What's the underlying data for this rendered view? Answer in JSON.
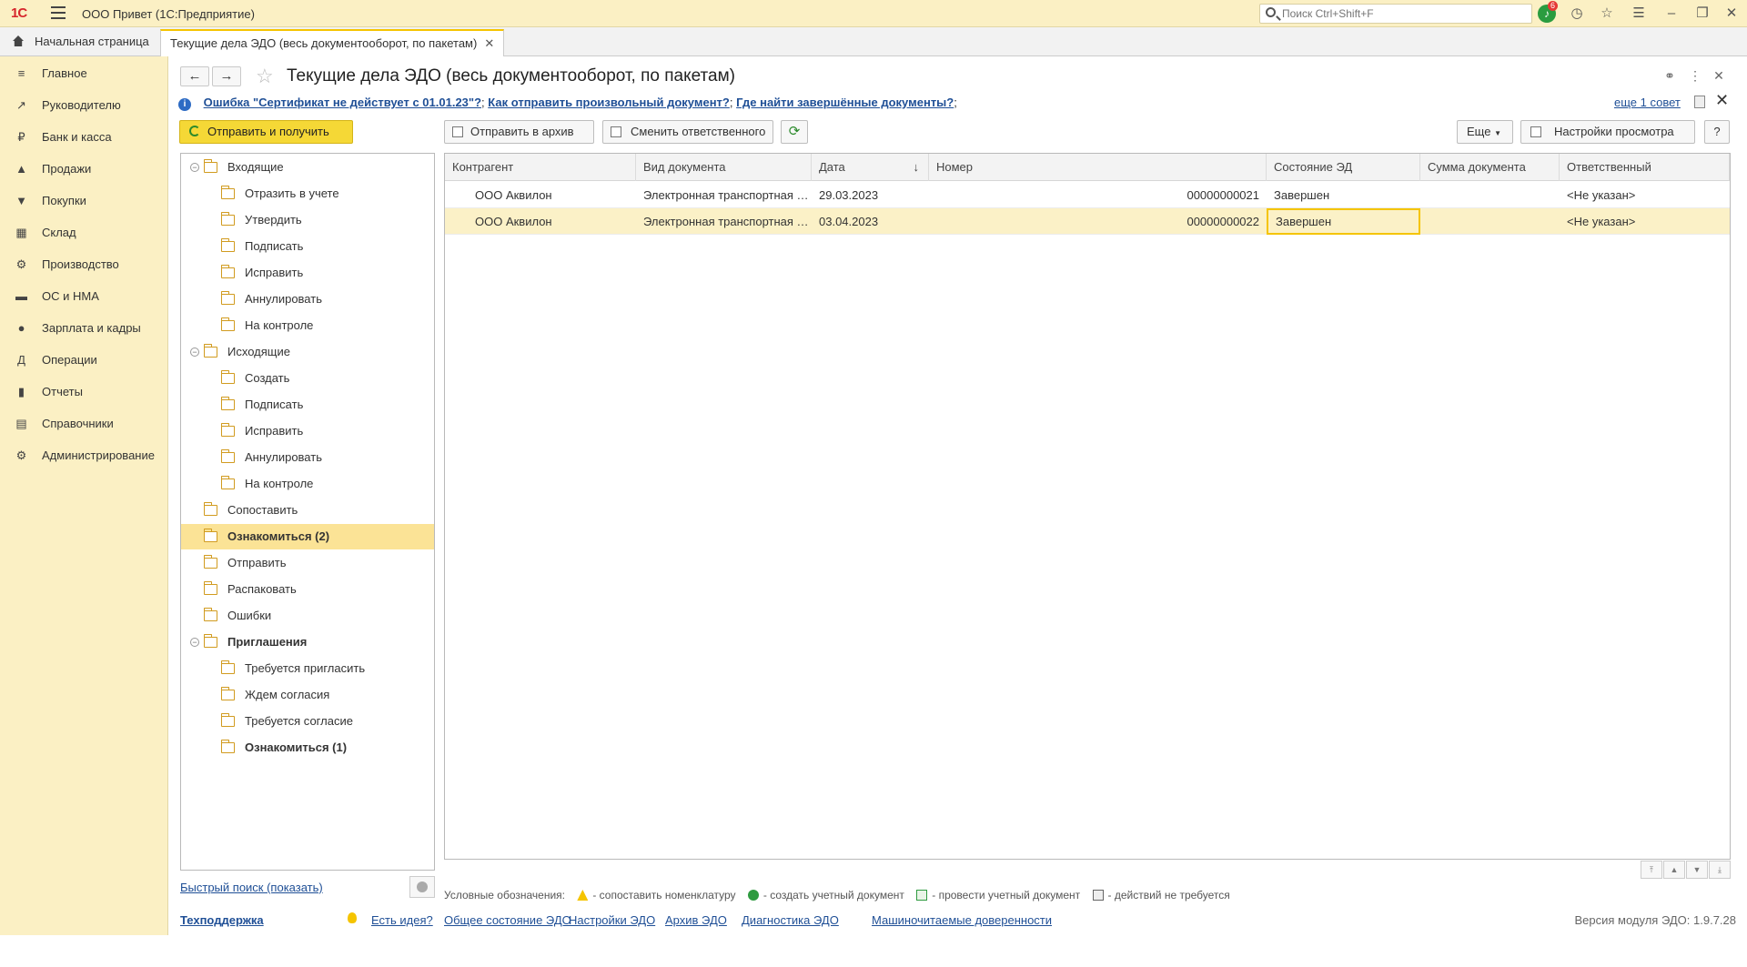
{
  "app": {
    "logo": "1С",
    "title": "ООО Привет  (1С:Предприятие)",
    "search_placeholder": "Поиск Ctrl+Shift+F",
    "notifications_count": "6"
  },
  "tabs": {
    "home_label": "Начальная страница",
    "current_label": "Текущие дела ЭДО (весь документооборот, по пакетам)"
  },
  "sidebar": {
    "items": [
      {
        "label": "Главное",
        "icon": "≡"
      },
      {
        "label": "Руководителю",
        "icon": "↗"
      },
      {
        "label": "Банк и касса",
        "icon": "₽"
      },
      {
        "label": "Продажи",
        "icon": "▲"
      },
      {
        "label": "Покупки",
        "icon": "▼"
      },
      {
        "label": "Склад",
        "icon": "▦"
      },
      {
        "label": "Производство",
        "icon": "⚙"
      },
      {
        "label": "ОС и НМА",
        "icon": "▬"
      },
      {
        "label": "Зарплата и кадры",
        "icon": "●"
      },
      {
        "label": "Операции",
        "icon": "Д"
      },
      {
        "label": "Отчеты",
        "icon": "▮"
      },
      {
        "label": "Справочники",
        "icon": "▤"
      },
      {
        "label": "Администрирование",
        "icon": "⚙"
      }
    ]
  },
  "form": {
    "title": "Текущие дела ЭДО (весь документооборот, по пакетам)"
  },
  "tips": {
    "link1": "Ошибка \"Сертификат не действует с 01.01.23\"?",
    "link2": "Как отправить произвольный документ?",
    "link3": "Где найти завершённые документы?",
    "sep": ";",
    "more": "еще 1 совет"
  },
  "toolbar": {
    "send_receive": "Отправить и получить",
    "archive": "Отправить в архив",
    "change_responsible": "Сменить ответственного",
    "more": "Еще",
    "view_settings": "Настройки просмотра",
    "help": "?"
  },
  "tree": [
    {
      "label": "Входящие",
      "level": 0,
      "expander": true,
      "bold": false
    },
    {
      "label": "Отразить в учете",
      "level": 1
    },
    {
      "label": "Утвердить",
      "level": 1
    },
    {
      "label": "Подписать",
      "level": 1
    },
    {
      "label": "Исправить",
      "level": 1
    },
    {
      "label": "Аннулировать",
      "level": 1
    },
    {
      "label": "На контроле",
      "level": 1
    },
    {
      "label": "Исходящие",
      "level": 0,
      "expander": true
    },
    {
      "label": "Создать",
      "level": 1
    },
    {
      "label": "Подписать",
      "level": 1
    },
    {
      "label": "Исправить",
      "level": 1
    },
    {
      "label": "Аннулировать",
      "level": 1
    },
    {
      "label": "На контроле",
      "level": 1
    },
    {
      "label": "Сопоставить",
      "level": 0
    },
    {
      "label": "Ознакомиться (2)",
      "level": 0,
      "bold": true,
      "selected": true
    },
    {
      "label": "Отправить",
      "level": 0
    },
    {
      "label": "Распаковать",
      "level": 0
    },
    {
      "label": "Ошибки",
      "level": 0
    },
    {
      "label": "Приглашения",
      "level": 0,
      "expander": true,
      "bold": true
    },
    {
      "label": "Требуется пригласить",
      "level": 1
    },
    {
      "label": "Ждем согласия",
      "level": 1
    },
    {
      "label": "Требуется согласие",
      "level": 1
    },
    {
      "label": "Ознакомиться (1)",
      "level": 1,
      "bold": true
    }
  ],
  "grid": {
    "columns": [
      "Контрагент",
      "Вид документа",
      "Дата",
      "Номер",
      "Состояние ЭД",
      "Сумма документа",
      "Ответственный"
    ],
    "sort_indicator": "↓",
    "rows": [
      [
        "ООО Аквилон",
        "Электронная транспортная накладная",
        "29.03.2023",
        "00000000021",
        "Завершен",
        "",
        "<Не указан>"
      ],
      [
        "ООО Аквилон",
        "Электронная транспортная накладная",
        "03.04.2023",
        "00000000022",
        "Завершен",
        "",
        "<Не указан>"
      ]
    ]
  },
  "quick_search": "Быстрый поиск (показать)",
  "legend": {
    "title": "Условные обозначения:",
    "items": [
      "- сопоставить номенклатуру",
      "- создать учетный документ",
      "- провести учетный документ",
      "- действий не требуется"
    ]
  },
  "footer": {
    "support": "Техподдержка",
    "idea": "Есть идея?",
    "links": [
      "Общее состояние ЭДО",
      "Настройки ЭДО",
      "Архив ЭДО",
      "Диагностика ЭДО",
      "Машиночитаемые доверенности"
    ],
    "version": "Версия модуля ЭДО: 1.9.7.28"
  }
}
